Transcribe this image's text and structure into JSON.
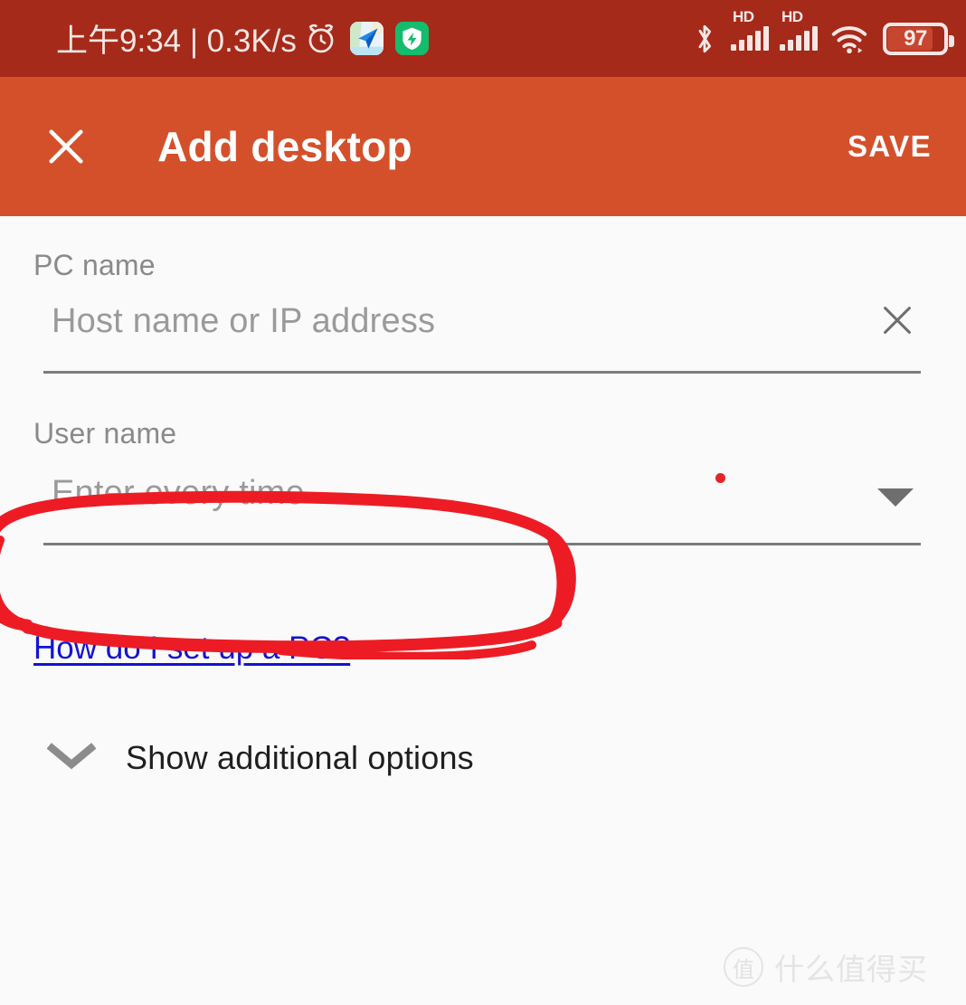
{
  "status_bar": {
    "clock": "上午9:34 | 0.3K/s",
    "alarm_icon": "alarm-clock-icon",
    "maps_app_icon": "maps-navigation-icon",
    "shield_app_icon": "security-shield-icon",
    "bluetooth_icon": "bluetooth-icon",
    "signal_1_label": "HD",
    "signal_2_label": "HD",
    "wifi_icon": "wifi-icon",
    "battery_level": "97",
    "background_color": "#A52A1A",
    "foreground_color": "#F7E7E4"
  },
  "app_bar": {
    "close_icon": "close-x-icon",
    "title": "Add desktop",
    "save_label": "SAVE",
    "background_color": "#D4502A",
    "text_color": "#FFFFFF"
  },
  "form": {
    "pc_name": {
      "label": "PC name",
      "placeholder": "Host name or IP address",
      "value": "",
      "clear_icon": "clear-x-icon"
    },
    "user_name": {
      "label": "User name",
      "selected_option": "Enter every time",
      "dropdown_icon": "chevron-down-caret-icon"
    },
    "required_marker_color": "#E5242A",
    "help_link": "How do I set up a PC?",
    "help_link_color": "#1414D2",
    "additional_options": {
      "label": "Show additional options",
      "icon": "chevron-down-icon"
    }
  },
  "annotation": {
    "shape": "hand-drawn-red-ellipse",
    "color": "#ED1C24",
    "target": "PC name host field"
  },
  "watermark": {
    "badge": "值",
    "text": "什么值得买",
    "color": "#E4E4E4"
  }
}
